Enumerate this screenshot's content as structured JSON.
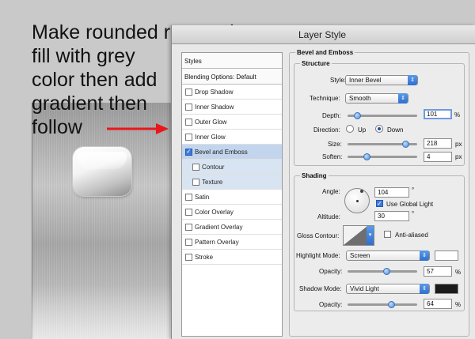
{
  "instruction": {
    "lines": [
      "Make rounded rectangle",
      "fill with grey",
      "color then add",
      "gradient then",
      "follow"
    ]
  },
  "dialog": {
    "title": "Layer Style",
    "styles_list": {
      "header": "Styles",
      "blending": "Blending Options: Default",
      "items": [
        {
          "label": "Drop Shadow",
          "checked": false
        },
        {
          "label": "Inner Shadow",
          "checked": false
        },
        {
          "label": "Outer Glow",
          "checked": false
        },
        {
          "label": "Inner Glow",
          "checked": false
        },
        {
          "label": "Bevel and Emboss",
          "checked": true
        },
        {
          "label": "Contour",
          "checked": false
        },
        {
          "label": "Texture",
          "checked": false
        },
        {
          "label": "Satin",
          "checked": false
        },
        {
          "label": "Color Overlay",
          "checked": false
        },
        {
          "label": "Gradient Overlay",
          "checked": false
        },
        {
          "label": "Pattern Overlay",
          "checked": false
        },
        {
          "label": "Stroke",
          "checked": false
        }
      ]
    },
    "bevel": {
      "heading": "Bevel and Emboss",
      "structure_heading": "Structure",
      "style_label": "Style:",
      "style_value": "Inner Bevel",
      "technique_label": "Technique:",
      "technique_value": "Smooth",
      "depth_label": "Depth:",
      "depth_value": "101",
      "depth_unit": "%",
      "depth_level": 0.1,
      "direction_label": "Direction:",
      "direction_up": "Up",
      "direction_down": "Down",
      "direction_selected": "Down",
      "size_label": "Size:",
      "size_value": "218",
      "size_unit": "px",
      "size_level": 0.87,
      "soften_label": "Soften:",
      "soften_value": "4",
      "soften_unit": "px",
      "soften_level": 0.25
    },
    "shading": {
      "heading": "Shading",
      "angle_label": "Angle:",
      "angle_value": "104",
      "angle_unit": "°",
      "global_light_label": "Use Global Light",
      "global_light_checked": true,
      "altitude_label": "Altitude:",
      "altitude_value": "30",
      "altitude_unit": "°",
      "gloss_label": "Gloss Contour:",
      "anti_aliased_label": "Anti-aliased",
      "anti_aliased_checked": false,
      "highlight_mode_label": "Highlight Mode:",
      "highlight_mode_value": "Screen",
      "highlight_color": "#ffffff",
      "highlight_opacity_label": "Opacity:",
      "highlight_opacity_value": "57",
      "highlight_opacity_unit": "%",
      "highlight_opacity_level": 0.57,
      "shadow_mode_label": "Shadow Mode:",
      "shadow_mode_value": "Vivid Light",
      "shadow_color": "#1a1a1a",
      "shadow_opacity_label": "Opacity:",
      "shadow_opacity_value": "64",
      "shadow_opacity_unit": "%",
      "shadow_opacity_level": 0.64
    }
  },
  "colors": {
    "arrow": "#e8171c",
    "selection": "#c2d5ed",
    "accent": "#3e7bd6"
  }
}
